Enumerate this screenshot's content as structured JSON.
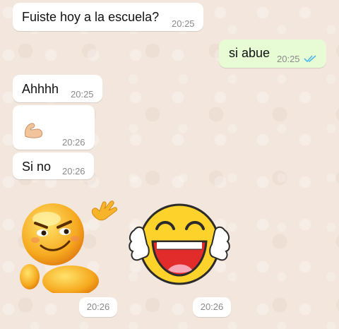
{
  "chat": {
    "messages": [
      {
        "direction": "incoming",
        "text": "Fuiste hoy a la escuela?",
        "time": "20:25"
      },
      {
        "direction": "outgoing",
        "text": "si abue",
        "time": "20:25",
        "status": "read"
      },
      {
        "direction": "incoming",
        "text": "Ahhhh",
        "time": "20:25"
      },
      {
        "direction": "incoming",
        "emoji": "flexed-biceps-icon",
        "time": "20:26"
      },
      {
        "direction": "incoming",
        "text": "Si no",
        "time": "20:26"
      }
    ],
    "stickers": [
      {
        "name": "smirking-emoji-sticker",
        "time": "20:26"
      },
      {
        "name": "laughing-emoji-sticker",
        "time": "20:26"
      }
    ]
  },
  "colors": {
    "incoming_bubble": "#ffffff",
    "outgoing_bubble": "#e7fbd5",
    "read_ticks": "#4fb6ec",
    "wallpaper": "#f3e7dd"
  }
}
